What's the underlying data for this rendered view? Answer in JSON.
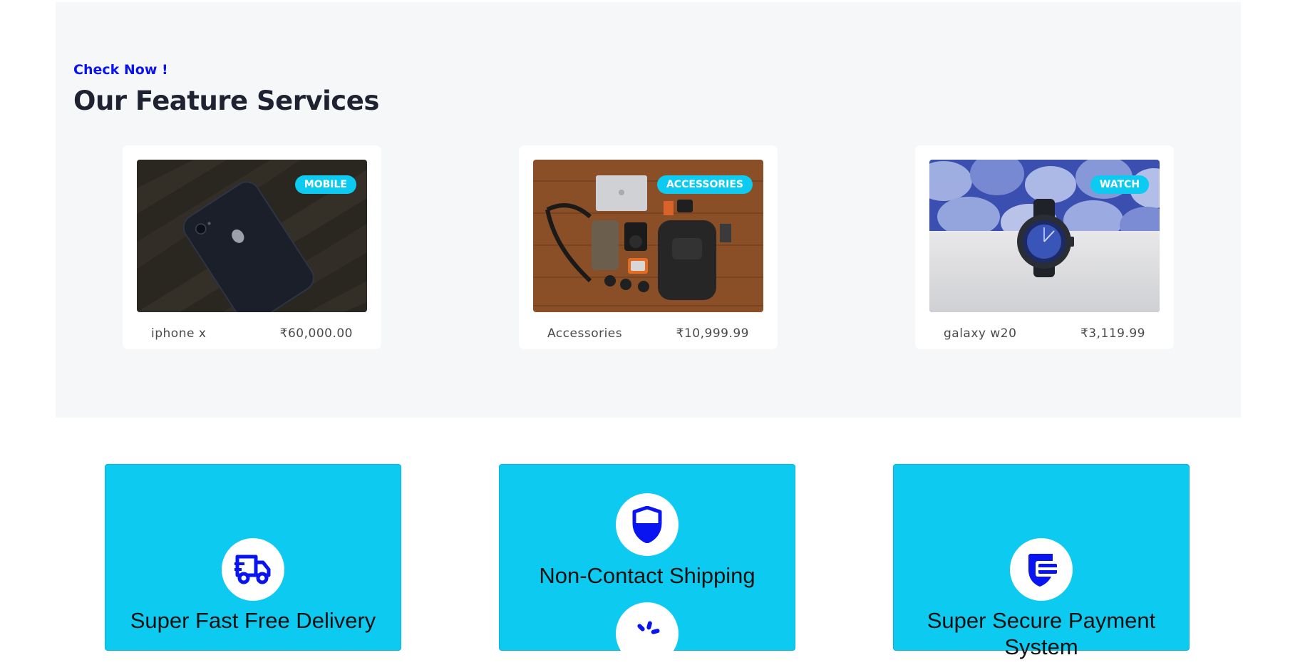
{
  "feature": {
    "eyebrow": "Check Now !",
    "title": "Our Feature Services"
  },
  "products": [
    {
      "tag": "Mobile",
      "name": "iphone x",
      "price": "₹60,000.00",
      "image": "dark-phone-photo"
    },
    {
      "tag": "Accessories",
      "name": "Accessories",
      "price": "₹10,999.99",
      "image": "accessories-flatlay-photo"
    },
    {
      "tag": "Watch",
      "name": "galaxy w20",
      "price": "₹3,119.99",
      "image": "smartwatch-photo"
    }
  ],
  "services": [
    {
      "label": "Super Fast Free Delivery",
      "icon": "truck-icon"
    },
    {
      "label": "Non-Contact Shipping",
      "icon": "shield-icon",
      "extra_icon": "spinner-icon"
    },
    {
      "label": "Super Secure Payment System",
      "icon": "secure-payment-icon"
    }
  ],
  "colors": {
    "accent": "#0dcaf0",
    "eyebrow": "#0a14f0",
    "icon": "#0a14f0",
    "section_bg": "#f6f7f9"
  }
}
